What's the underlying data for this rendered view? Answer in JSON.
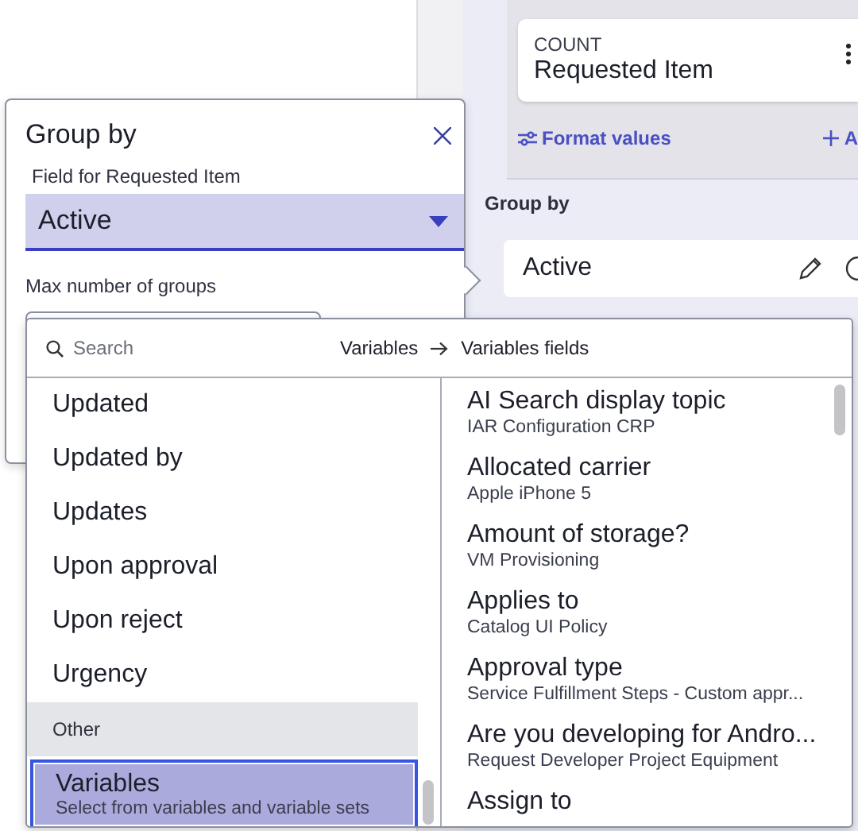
{
  "report_panel": {
    "count_card": {
      "label": "COUNT",
      "value": "Requested Item"
    },
    "format_values_link": "Format values",
    "add_link": "A",
    "group_by_label": "Group by",
    "group_by_chip": {
      "value": "Active"
    }
  },
  "group_by_popup": {
    "title": "Group by",
    "field_label": "Field for Requested Item",
    "field_value": "Active",
    "max_groups_label": "Max number of groups"
  },
  "field_picker": {
    "search": {
      "placeholder": "Search"
    },
    "breadcrumb": [
      "Variables",
      "Variables fields"
    ],
    "fields": [
      {
        "kind": "item",
        "label": "Updated",
        "selected": false
      },
      {
        "kind": "item",
        "label": "Updated by",
        "selected": false
      },
      {
        "kind": "item",
        "label": "Updates",
        "selected": false
      },
      {
        "kind": "item",
        "label": "Upon approval",
        "selected": false
      },
      {
        "kind": "item",
        "label": "Upon reject",
        "selected": false
      },
      {
        "kind": "item",
        "label": "Urgency",
        "selected": false
      },
      {
        "kind": "header",
        "label": "Other"
      },
      {
        "kind": "item",
        "label": "Variables",
        "description": "Select from variables and variable sets",
        "selected": true
      }
    ],
    "variables": [
      {
        "label": "AI Search display topic",
        "source": "IAR Configuration CRP"
      },
      {
        "label": "Allocated carrier",
        "source": "Apple iPhone 5"
      },
      {
        "label": "Amount of storage?",
        "source": "VM Provisioning"
      },
      {
        "label": "Applies to",
        "source": "Catalog UI Policy"
      },
      {
        "label": "Approval type",
        "source": "Service Fulfillment Steps - Custom appr..."
      },
      {
        "label": "Are you developing for Andro...",
        "source": "Request Developer Project Equipment"
      },
      {
        "label": "Assign to"
      }
    ]
  }
}
